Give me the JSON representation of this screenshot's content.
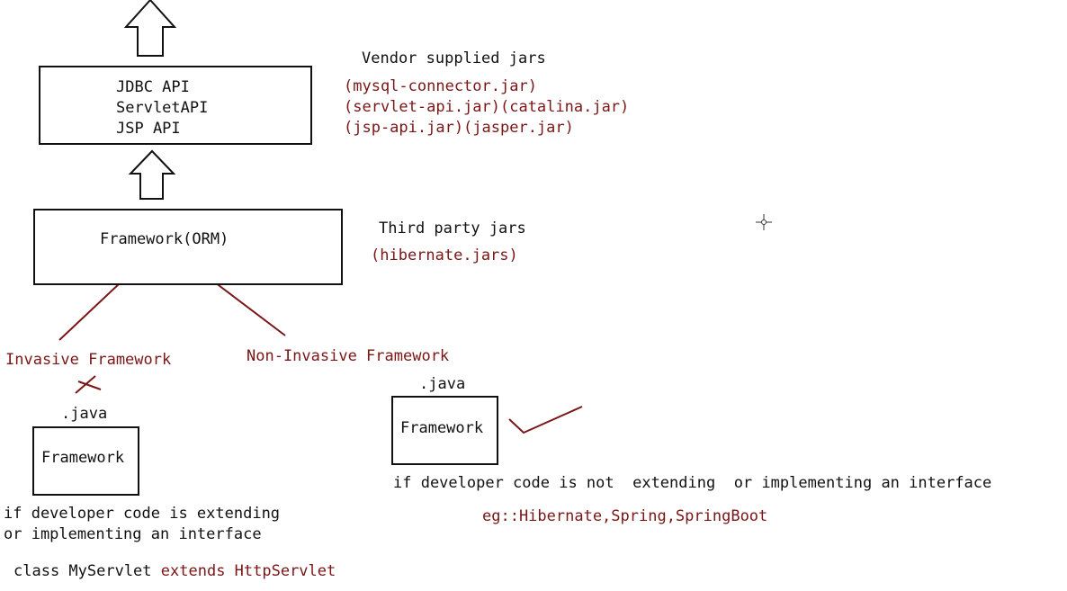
{
  "api_box": {
    "lines": [
      "JDBC API",
      "ServletAPI",
      "JSP API"
    ]
  },
  "vendor": {
    "title": "Vendor supplied jars",
    "jars": [
      "(mysql-connector.jar)",
      "(servlet-api.jar)(catalina.jar)",
      "(jsp-api.jar)(jasper.jar)"
    ]
  },
  "framework_box": {
    "label": "Framework(ORM)"
  },
  "third_party": {
    "title": "Third party jars",
    "jars": "(hibernate.jars)"
  },
  "invasive": {
    "title": "Invasive Framework",
    "file_label": ".java",
    "box_label": "Framework",
    "desc_line1": "if developer code is extending",
    "desc_line2": "or implementing an interface",
    "code_prefix": "class MyServlet",
    "code_keyword": "extends HttpServlet"
  },
  "non_invasive": {
    "title": "Non-Invasive Framework",
    "file_label": ".java",
    "box_label": "Framework",
    "desc": "if developer code is not  extending  or implementing an interface",
    "example": "eg::Hibernate,Spring,SpringBoot"
  },
  "colors": {
    "ink": "#111111",
    "annotation": "#7a1616"
  }
}
